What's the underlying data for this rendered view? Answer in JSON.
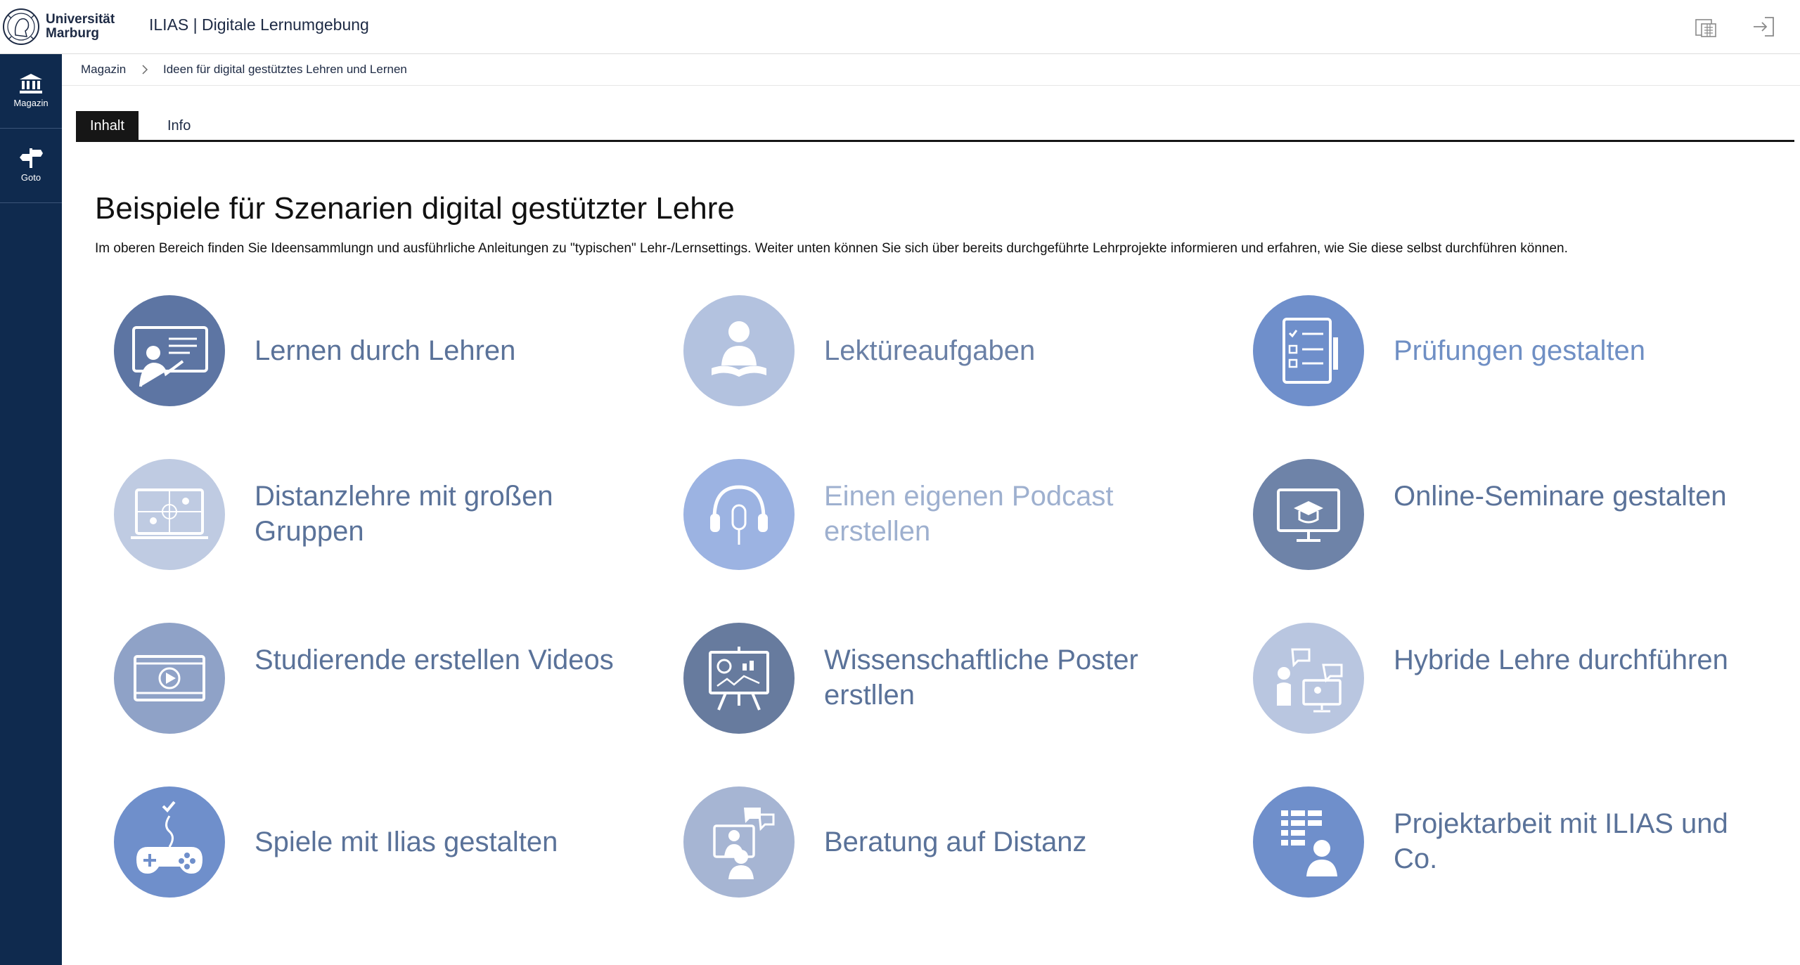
{
  "header": {
    "logo_line1": "Universität",
    "logo_line2": "Marburg",
    "app_title": "ILIAS | Digitale Lernumgebung"
  },
  "sidebar": {
    "items": [
      {
        "label": "Magazin",
        "icon": "bank-icon"
      },
      {
        "label": "Goto",
        "icon": "signpost-icon"
      }
    ]
  },
  "breadcrumb": {
    "items": [
      "Magazin",
      "Ideen für digital gestütztes Lehren und Lernen"
    ]
  },
  "tabs": [
    {
      "label": "Inhalt",
      "active": true
    },
    {
      "label": "Info",
      "active": false
    }
  ],
  "main": {
    "title": "Beispiele für Szenarien digital gestützter Lehre",
    "intro": "Im oberen Bereich finden Sie Ideensammlungn und ausführliche Anleitungen zu \"typischen\" Lehr-/Lernsettings. Weiter unten können Sie sich über bereits durchgeführte Lehrprojekte informieren und erfahren, wie Sie diese selbst durchführen können.",
    "cards": [
      {
        "label": "Lernen durch Lehren",
        "icon": "teacher-board-icon",
        "circle_color": "#5d75a3",
        "text_color": "#5a7299"
      },
      {
        "label": "Lektüreaufgaben",
        "icon": "reader-book-icon",
        "circle_color": "#b3c2df",
        "text_color": "#6a80a6"
      },
      {
        "label": "Prüfungen gestalten",
        "icon": "exam-checklist-icon",
        "circle_color": "#6f8fcb",
        "text_color": "#6f8fc4"
      },
      {
        "label": "Distanzlehre mit großen Gruppen",
        "icon": "video-conference-icon",
        "circle_color": "#bfcbe2",
        "text_color": "#5a7299"
      },
      {
        "label": "Einen eigenen Podcast erstellen",
        "icon": "headphones-microphone-icon",
        "circle_color": "#9cb3e2",
        "text_color": "#9eb0cf"
      },
      {
        "label": "Online-Seminare gestalten",
        "icon": "online-seminar-icon",
        "circle_color": "#6e83a8",
        "text_color": "#5a7299"
      },
      {
        "label": "Studierende erstellen Videos",
        "icon": "video-play-icon",
        "circle_color": "#8fa2c7",
        "text_color": "#5a7299"
      },
      {
        "label": "Wissenschaftliche Poster erstllen",
        "icon": "poster-easel-icon",
        "circle_color": "#677b9e",
        "text_color": "#5a7299"
      },
      {
        "label": "Hybride Lehre durchführen",
        "icon": "hybrid-teaching-icon",
        "circle_color": "#b9c6e0",
        "text_color": "#5a7299"
      },
      {
        "label": "Spiele mit Ilias gestalten",
        "icon": "gamepad-icon",
        "circle_color": "#6f8fcb",
        "text_color": "#5a7299"
      },
      {
        "label": "Beratung auf Distanz",
        "icon": "remote-consultation-icon",
        "circle_color": "#a6b5d3",
        "text_color": "#5a7299"
      },
      {
        "label": "Projektarbeit mit ILIAS und Co.",
        "icon": "project-board-icon",
        "circle_color": "#6f8fcb",
        "text_color": "#5a7299"
      }
    ]
  }
}
